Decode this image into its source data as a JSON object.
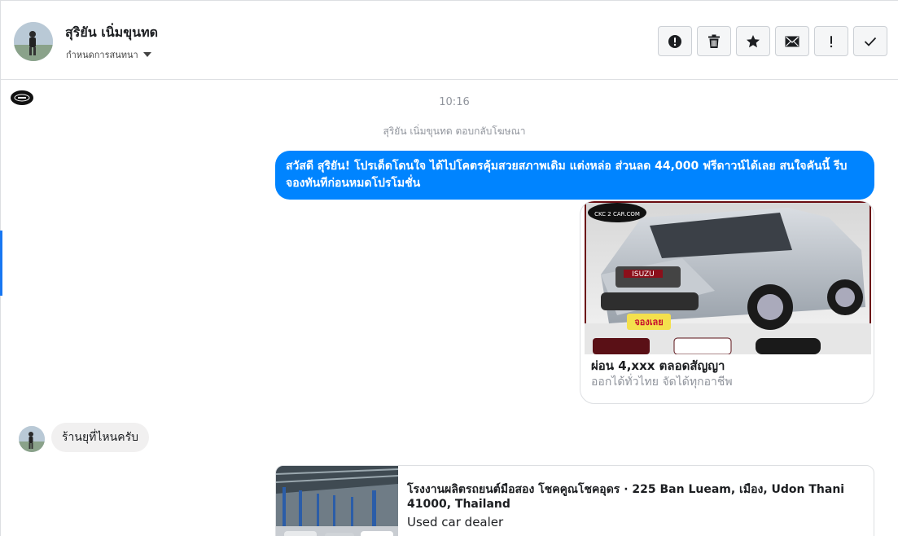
{
  "header": {
    "contact_name": "สุริยัน เนิ่มขุนทด",
    "assign_label": "กำหนดการสนทนา",
    "actions": [
      {
        "name": "report-spam-button",
        "icon": "alert-circle-icon"
      },
      {
        "name": "delete-button",
        "icon": "trash-icon"
      },
      {
        "name": "star-button",
        "icon": "star-icon"
      },
      {
        "name": "mark-unread-button",
        "icon": "envelope-icon"
      },
      {
        "name": "follow-up-button",
        "icon": "exclamation-icon"
      },
      {
        "name": "mark-done-button",
        "icon": "checkmark-icon"
      }
    ]
  },
  "conversation": {
    "timestamp": "10:16",
    "replied_to_ad": "สุริยัน เนิ่มขุนทด ตอบกลับโฆษณา",
    "outgoing_message": "สวัสดี สุริยัน! โปรเด็ดโดนใจ ได้ไปโคตรคุ้มสวยสภาพเดิม แต่งหล่อ  ส่วนลด 44,000 ฟรีดาวน์ได้เลย  สนใจคันนี้ รีบจองทันทีก่อนหมดโปรโมชั่น",
    "ad_card": {
      "title": "ผ่อน 4,xxx ตลอดสัญญา",
      "subtitle": "ออกได้ทั่วไทย จัดได้ทุกอาชีพ",
      "image_brand_text": "CKC 2 CAR.COM",
      "image_badge_text": "จองเลย",
      "image_plate_text": "ISUZU"
    },
    "incoming_message": "ร้านยุที่ไหนครับ",
    "location_card": {
      "title": "โรงงานผลิตรถยนต์มือสอง โชคคูณโชคอุดร · 225 Ban Lueam, เมือง, Udon Thani 41000, Thailand",
      "subtitle": "Used car dealer"
    }
  },
  "colors": {
    "outgoing_bubble": "#0084ff",
    "incoming_bubble": "#f1f0f0",
    "accent": "#1877f2"
  }
}
